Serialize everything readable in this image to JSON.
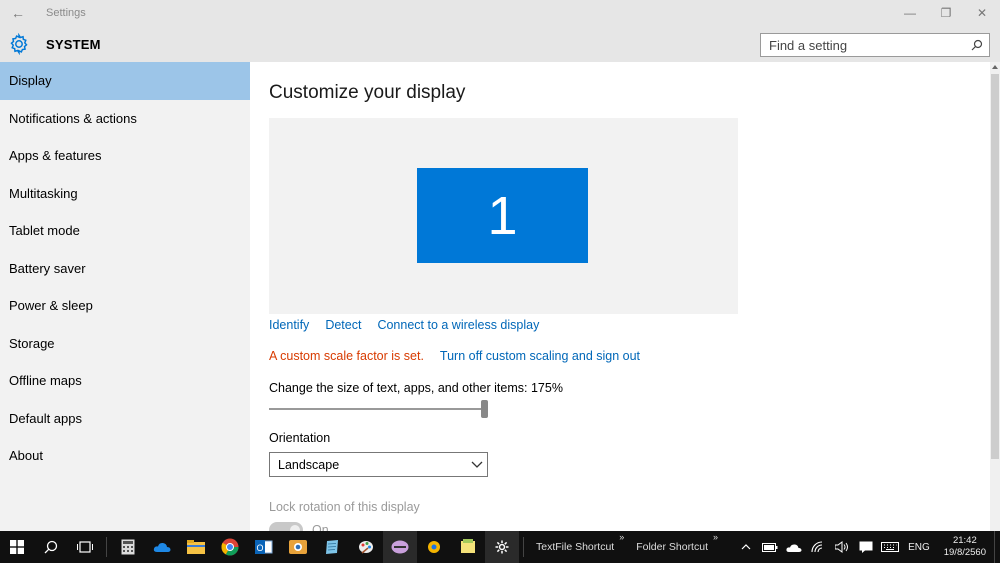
{
  "window": {
    "title": "Settings",
    "back_glyph": "←",
    "minimize_glyph": "—",
    "restore_glyph": "❐",
    "close_glyph": "✕"
  },
  "header": {
    "section_title": "SYSTEM",
    "icon": "gear-icon",
    "search_placeholder": "Find a setting"
  },
  "sidebar": {
    "items": [
      {
        "label": "Display",
        "active": true
      },
      {
        "label": "Notifications & actions"
      },
      {
        "label": "Apps & features"
      },
      {
        "label": "Multitasking"
      },
      {
        "label": "Tablet mode"
      },
      {
        "label": "Battery saver"
      },
      {
        "label": "Power & sleep"
      },
      {
        "label": "Storage"
      },
      {
        "label": "Offline maps"
      },
      {
        "label": "Default apps"
      },
      {
        "label": "About"
      }
    ]
  },
  "main": {
    "title": "Customize your display",
    "monitor_number": "1",
    "links": [
      "Identify",
      "Detect",
      "Connect to a wireless display"
    ],
    "warning_text": "A custom scale factor is set.",
    "warning_link": "Turn off custom scaling and sign out",
    "scale_label": "Change the size of text, apps, and other items: 175%",
    "scale_value_fraction": 1.0,
    "orientation_label": "Orientation",
    "orientation_value": "Landscape",
    "lock_rotation_label": "Lock rotation of this display",
    "lock_rotation_state": "On"
  },
  "taskbar": {
    "toolbars": [
      "TextFile Shortcut",
      "Folder Shortcut"
    ],
    "toolbar_chevron": "»",
    "language": "ENG",
    "time": "21:42",
    "date": "19/8/2560"
  },
  "colors": {
    "accent": "#0078d7",
    "link": "#0067b8",
    "warning": "#d83b01",
    "active_nav": "#9cc5e8"
  }
}
